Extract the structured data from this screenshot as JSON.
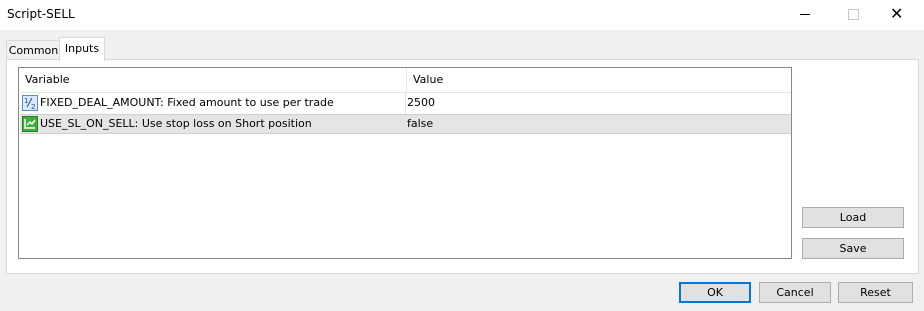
{
  "window": {
    "title": "Script-SELL"
  },
  "tabs": [
    {
      "label": "Common"
    },
    {
      "label": "Inputs"
    }
  ],
  "grid": {
    "columns": [
      "Variable",
      "Value"
    ],
    "rows": [
      {
        "icon": "number-param-icon",
        "variable": "FIXED_DEAL_AMOUNT: Fixed amount to use per trade",
        "value": "2500"
      },
      {
        "icon": "boolean-param-icon",
        "variable": "USE_SL_ON_SELL: Use stop loss on Short position",
        "value": "false"
      }
    ]
  },
  "side_buttons": {
    "load": "Load",
    "save": "Save"
  },
  "footer_buttons": {
    "ok": "OK",
    "cancel": "Cancel",
    "reset": "Reset"
  }
}
